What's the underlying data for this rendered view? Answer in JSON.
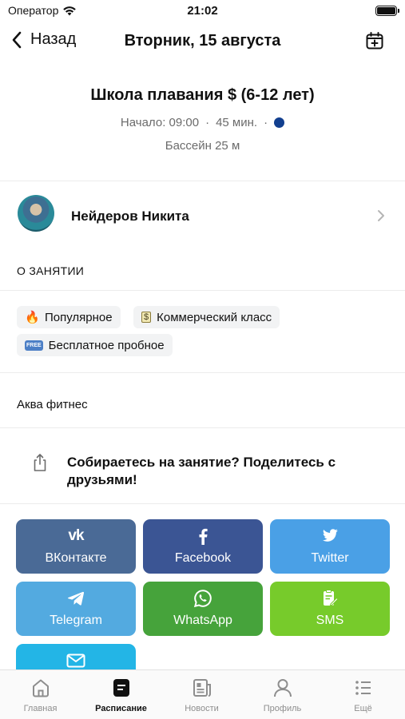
{
  "status_bar": {
    "carrier": "Оператор",
    "time": "21:02"
  },
  "nav": {
    "back_label": "Назад",
    "title": "Вторник, 15 августа"
  },
  "class": {
    "title": "Школа плавания $ (6-12 лет)",
    "start": "Начало: 09:00",
    "separator": "·",
    "duration": "45 мин.",
    "location": "Бассейн 25 м",
    "dot_color": "#123f8f"
  },
  "trainer": {
    "name": "Нейдеров Никита"
  },
  "about": {
    "label": "О ЗАНЯТИИ",
    "tags": [
      {
        "icon": "fire-emoji",
        "glyph": "🔥",
        "label": "Популярное"
      },
      {
        "icon": "money-emoji",
        "glyph": "$",
        "label": "Коммерческий класс"
      },
      {
        "icon": "free-emoji",
        "glyph": "FREE",
        "label": "Бесплатное пробное"
      }
    ],
    "category": "Аква фитнес"
  },
  "share": {
    "text": "Собираетесь на занятие? Поделитесь с друзьями!",
    "buttons": [
      {
        "icon": "vk-icon",
        "glyph": "vk",
        "label": "ВКонтакте",
        "color": "#4a6a96"
      },
      {
        "icon": "facebook-icon",
        "glyph": "f",
        "label": "Facebook",
        "color": "#3b5594"
      },
      {
        "icon": "twitter-icon",
        "glyph": "tw",
        "label": "Twitter",
        "color": "#4aa0e6"
      },
      {
        "icon": "telegram-icon",
        "glyph": "tg",
        "label": "Telegram",
        "color": "#53aae0"
      },
      {
        "icon": "whatsapp-icon",
        "glyph": "wa",
        "label": "WhatsApp",
        "color": "#46a33b"
      },
      {
        "icon": "sms-icon",
        "glyph": "sms",
        "label": "SMS",
        "color": "#77cb2b"
      },
      {
        "icon": "email-icon",
        "glyph": "mail",
        "label": "",
        "color": "#23b5e6"
      }
    ]
  },
  "tabbar": {
    "tabs": [
      {
        "icon": "home-icon",
        "label": "Главная"
      },
      {
        "icon": "schedule-icon",
        "label": "Расписание",
        "active": true
      },
      {
        "icon": "news-icon",
        "label": "Новости"
      },
      {
        "icon": "profile-icon",
        "label": "Профиль"
      },
      {
        "icon": "more-icon",
        "label": "Ещё"
      }
    ]
  }
}
